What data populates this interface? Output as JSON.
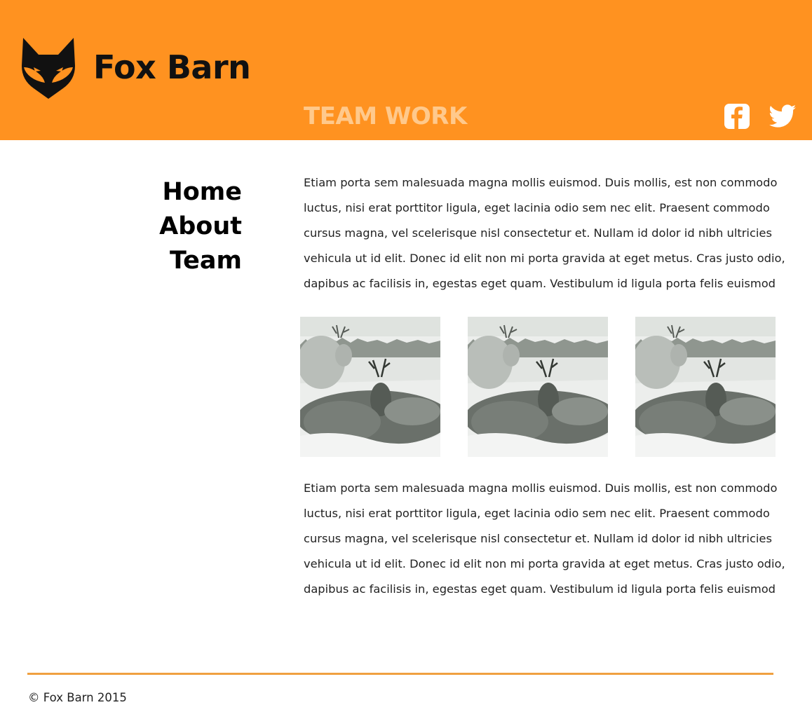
{
  "header": {
    "brand_name": "Fox Barn",
    "logo_icon": "fox-head-icon",
    "page_title": "TEAM WORK",
    "background_color": "#ff9220",
    "title_color": "#ffc98c",
    "social": [
      {
        "icon": "facebook-icon"
      },
      {
        "icon": "twitter-icon"
      }
    ]
  },
  "nav": {
    "items": [
      {
        "label": "Home"
      },
      {
        "label": "About"
      },
      {
        "label": "Team"
      }
    ]
  },
  "main": {
    "paragraphs": [
      "Etiam porta sem malesuada magna mollis euismod. Duis mollis, est non commodo luctus, nisi erat porttitor ligula, eget lacinia odio sem nec elit. Praesent commodo cursus magna, vel scelerisque nisl consectetur et. Nullam id dolor id nibh ultricies vehicula ut id elit. Donec id elit non mi porta gravida at eget metus. Cras justo odio, dapibus ac facilisis in, egestas eget quam. Vestibulum id ligula porta felis euismod",
      "Etiam porta sem malesuada magna mollis euismod. Duis mollis, est non commodo luctus, nisi erat porttitor ligula, eget lacinia odio sem nec elit. Praesent commodo cursus magna, vel scelerisque nisl consectetur et. Nullam id dolor id nibh ultricies vehicula ut id elit. Donec id elit non mi porta gravida at eget metus. Cras justo odio, dapibus ac facilisis in, egestas eget quam. Vestibulum id ligula porta felis euismod"
    ],
    "photos": [
      {
        "subject": "reindeer-photo"
      },
      {
        "subject": "reindeer-photo"
      },
      {
        "subject": "reindeer-photo"
      }
    ]
  },
  "footer": {
    "copyright": "© Fox Barn 2015",
    "rule_color": "#f0a040"
  }
}
